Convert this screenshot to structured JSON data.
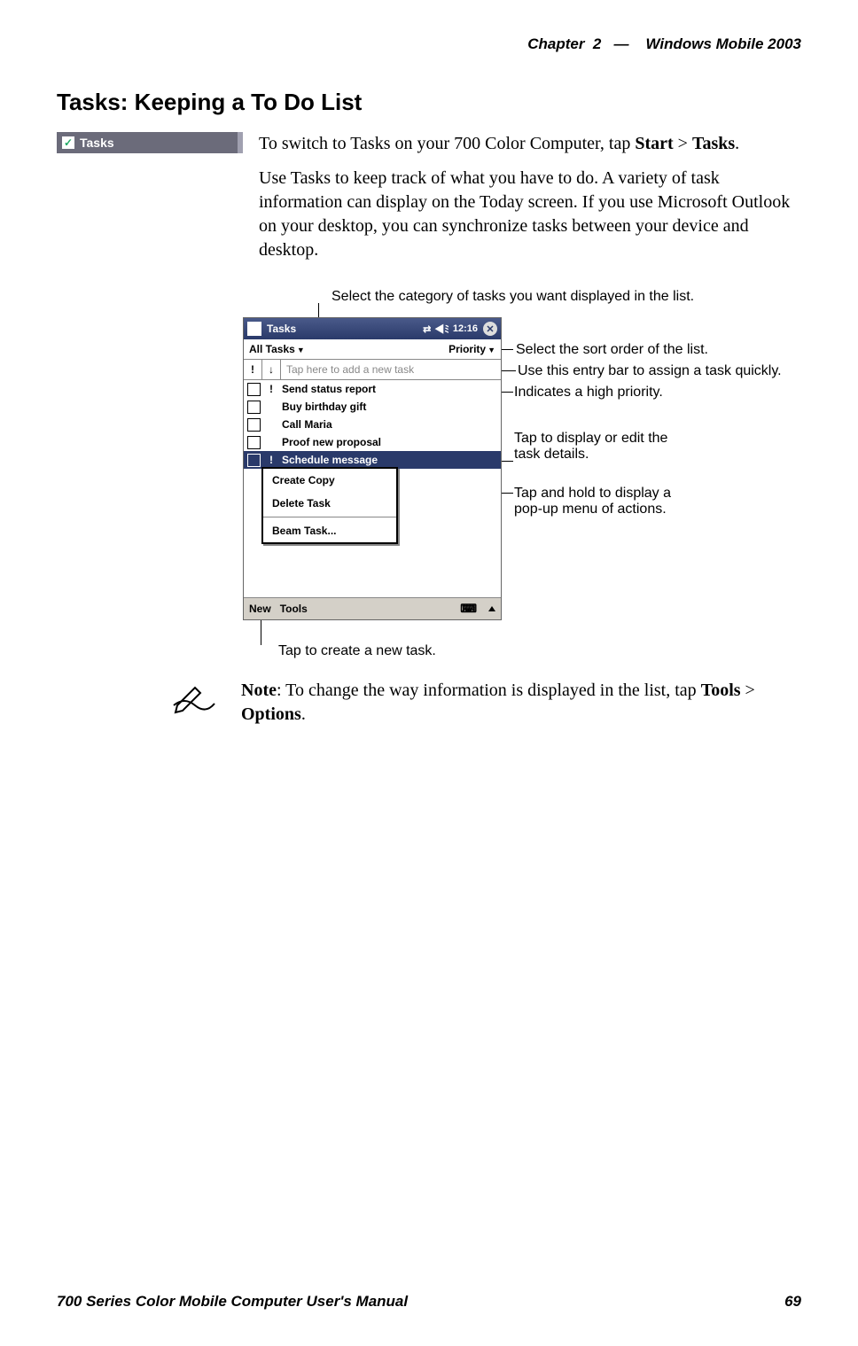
{
  "header": {
    "chapter": "Chapter",
    "chapter_num": "2",
    "sep": "—",
    "product": "Windows Mobile 2003"
  },
  "section_title": "Tasks: Keeping a To Do List",
  "tasks_badge": "Tasks",
  "intro": {
    "p1a": "To switch to Tasks on your 700 Color Computer, tap ",
    "p1b": "Start",
    "p1c": " > ",
    "p1d": "Tasks",
    "p1e": ".",
    "p2": "Use Tasks to keep track of what you have to do. A variety of task information can display on the Today screen. If you use Microsoft Outlook on your desktop, you can synchronize tasks between your device and desktop."
  },
  "annotations": {
    "top": "Select the category of tasks you want displayed in the list.",
    "sort": "Select the sort order of the list.",
    "entry": "Use this entry bar to assign a task quickly.",
    "priority": "Indicates a high priority.",
    "tap_edit_1": "Tap to display or edit the",
    "tap_edit_2": "task details.",
    "tap_hold_1": "Tap and hold to display a",
    "tap_hold_2": "pop-up menu of actions.",
    "new": "Tap to create a new task."
  },
  "screenshot": {
    "title": "Tasks",
    "time": "12:16",
    "category_filter": "All Tasks",
    "sort_by": "Priority",
    "entry_placeholder": "Tap here to add a new task",
    "tasks": [
      {
        "text": "Send status report",
        "priority": "!"
      },
      {
        "text": "Buy birthday gift",
        "priority": ""
      },
      {
        "text": "Call Maria",
        "priority": ""
      },
      {
        "text": "Proof new proposal",
        "priority": ""
      },
      {
        "text": "Schedule message",
        "priority": "!",
        "selected": true
      }
    ],
    "popup": {
      "create_copy": "Create Copy",
      "delete_task": "Delete Task",
      "beam_task": "Beam Task..."
    },
    "menu": {
      "new": "New",
      "tools": "Tools"
    }
  },
  "note": {
    "lead": "Note",
    "body_a": ": To change the way information is displayed in the list, tap ",
    "body_b": "Tools",
    "body_c": " > ",
    "body_d": "Options",
    "body_e": "."
  },
  "footer": {
    "manual": "700 Series Color Mobile Computer User's Manual",
    "page": "69"
  }
}
